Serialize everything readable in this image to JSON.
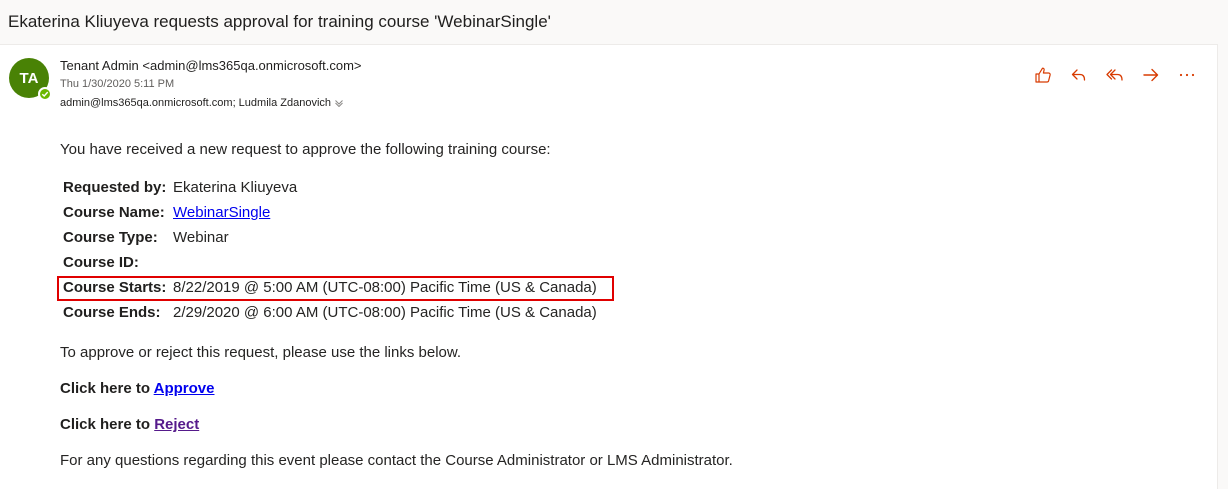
{
  "subject": "Ekaterina Kliuyeva requests approval for training course 'WebinarSingle'",
  "sender": {
    "initials": "TA",
    "from": "Tenant Admin <admin@lms365qa.onmicrosoft.com>",
    "date": "Thu 1/30/2020 5:11 PM",
    "recipients": "admin@lms365qa.onmicrosoft.com; Ludmila Zdanovich",
    "avatar_color": "#498205",
    "presence_color": "#6bb700"
  },
  "actions": [
    {
      "icon": "like-icon"
    },
    {
      "icon": "reply-icon"
    },
    {
      "icon": "reply-all-icon"
    },
    {
      "icon": "forward-icon"
    },
    {
      "icon": "more-icon"
    }
  ],
  "accent_color": "#d83b01",
  "body": {
    "intro": "You have received a new request to approve the following training course:",
    "details": {
      "requested_by": {
        "label": "Requested by:",
        "value": "Ekaterina Kliuyeva"
      },
      "course_name": {
        "label": "Course Name:",
        "value": "WebinarSingle"
      },
      "course_type": {
        "label": "Course Type:",
        "value": "Webinar"
      },
      "course_id": {
        "label": "Course ID:",
        "value": ""
      },
      "course_starts": {
        "label": "Course Starts:",
        "value": "8/22/2019 @ 5:00 AM (UTC-08:00) Pacific Time (US & Canada)"
      },
      "course_ends": {
        "label": "Course Ends:",
        "value": "2/29/2020 @ 6:00 AM (UTC-08:00) Pacific Time (US & Canada)"
      }
    },
    "instructions": "To approve or reject this request, please use the links below.",
    "approve_prefix": "Click here to ",
    "approve_link": "Approve",
    "reject_prefix": "Click here to ",
    "reject_link": "Reject",
    "footer": "For any questions regarding this event please contact the Course Administrator or LMS Administrator."
  },
  "highlight_color": "#e00000"
}
